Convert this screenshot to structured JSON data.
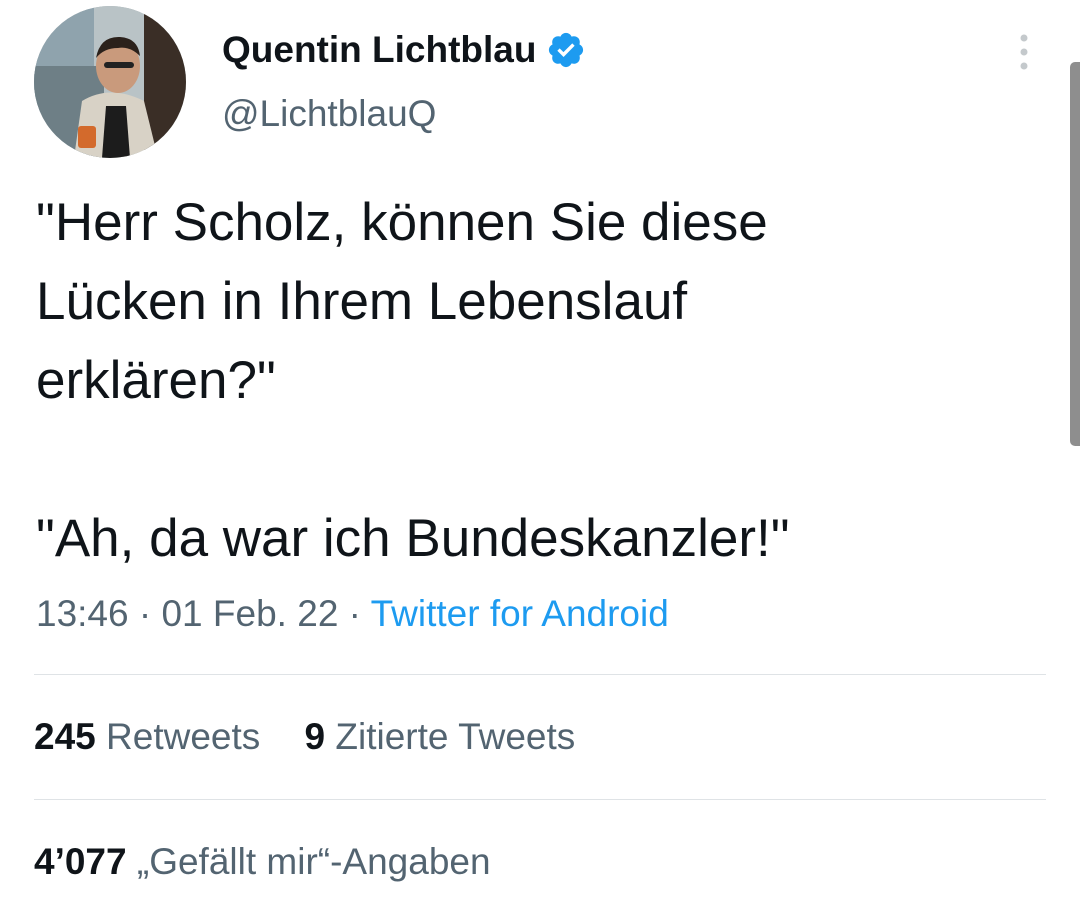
{
  "author": {
    "display_name": "Quentin Lichtblau",
    "handle": "@LichtblauQ",
    "verified": true,
    "verified_color": "#1d9bf0"
  },
  "tweet": {
    "text": "\"Herr Scholz, können Sie diese\nLücken in Ihrem Lebenslauf\nerklären?\"\n\n\"Ah, da war ich Bundeskanzler!\"",
    "time": "13:46",
    "date": "01 Feb. 22",
    "source": "Twitter for Android",
    "separator": "·"
  },
  "stats": {
    "retweets_count": "245",
    "retweets_label": "Retweets",
    "quotes_count": "9",
    "quotes_label": "Zitierte Tweets",
    "likes_count": "4’077",
    "likes_label": "„Gefällt mir“-Angaben"
  },
  "colors": {
    "text_primary": "#0f1419",
    "text_secondary": "#536471",
    "link": "#1d9bf0",
    "divider": "#dfe3e6"
  },
  "icons": {
    "verified": "verified-badge-icon",
    "more": "more-vertical-icon"
  }
}
